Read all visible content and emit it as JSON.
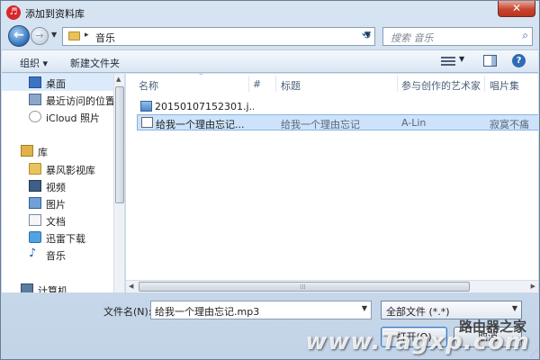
{
  "window": {
    "title": "添加到资料库",
    "close_glyph": "✕",
    "app_icon_glyph": "♬"
  },
  "address": {
    "segment": "音乐",
    "separator": "▸"
  },
  "search": {
    "placeholder": "搜索 音乐"
  },
  "toolbar": {
    "organize": "组织 ▾",
    "new_folder": "新建文件夹",
    "help_glyph": "?"
  },
  "sidebar": {
    "items": [
      {
        "label": "桌面",
        "icon": "desktop-icon"
      },
      {
        "label": "最近访问的位置",
        "icon": "recent-places-icon"
      },
      {
        "label": "iCloud 照片",
        "icon": "icloud-icon"
      },
      {
        "label": "库",
        "icon": "library-icon"
      },
      {
        "label": "暴风影视库",
        "icon": "folder-icon"
      },
      {
        "label": "视频",
        "icon": "video-icon"
      },
      {
        "label": "图片",
        "icon": "pictures-icon"
      },
      {
        "label": "文档",
        "icon": "documents-icon"
      },
      {
        "label": "迅雷下载",
        "icon": "download-icon"
      },
      {
        "label": "音乐",
        "icon": "music-icon"
      },
      {
        "label": "计算机",
        "icon": "computer-icon"
      }
    ]
  },
  "columns": [
    "名称",
    "#",
    "标题",
    "参与创作的艺术家",
    "唱片集"
  ],
  "files": [
    {
      "name": "20150107152301.j...",
      "number": "",
      "title": "",
      "artist": "",
      "album": ""
    },
    {
      "name": "给我一个理由忘记...",
      "number": "",
      "title": "给我一个理由忘记",
      "artist": "A-Lin",
      "album": "寂寞不痛"
    }
  ],
  "footer": {
    "filename_label": "文件名(N):",
    "filename_value": "给我一个理由忘记.mp3",
    "filetype_value": "全部文件 (*.*)",
    "open_button": "打开(O)",
    "cancel_button": "取消"
  },
  "watermark": {
    "text": "www.Tagxp.com",
    "brand": "路由器之家"
  }
}
